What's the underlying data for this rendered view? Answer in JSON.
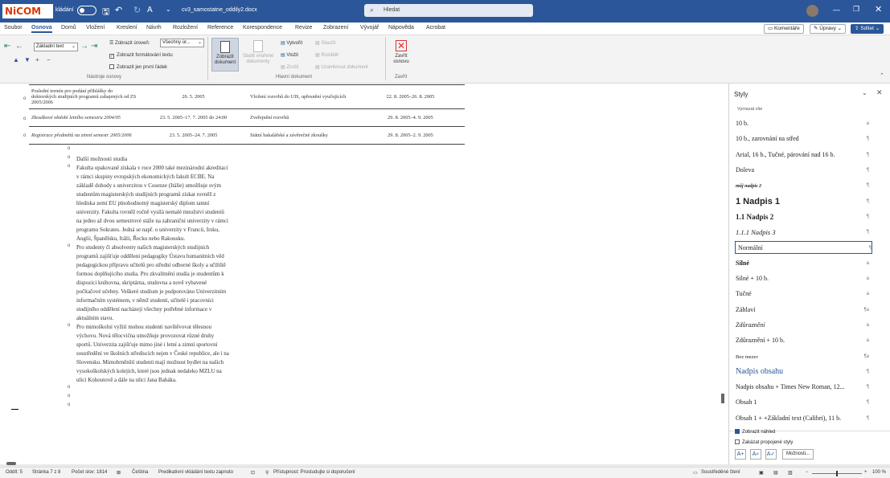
{
  "titlebar": {
    "logo": "NiCOM",
    "autosave": "kládání",
    "filename": "cv3_samostatne_oddily2.docx",
    "search_placeholder": "Hledat"
  },
  "menu": [
    "Soubor",
    "Osnova",
    "Domů",
    "Vložení",
    "Kreslení",
    "Návrh",
    "Rozložení",
    "Reference",
    "Korespondence",
    "Revize",
    "Zobrazení",
    "Vývojář",
    "Nápověda",
    "Acrobat"
  ],
  "menu_right": {
    "comments": "Komentáře",
    "edit": "Úpravy",
    "share": "Sdílet"
  },
  "ribbon": {
    "level_select": "Základní text",
    "show_level_label": "Zobrazit úroveň:",
    "show_level_value": "Všechny úr...",
    "show_formatting": "Zobrazit formátování textu",
    "show_first_line": "Zobrazit jen první řádek",
    "group1": "Nástroje osnovy",
    "show_document": "Zobrazit dokument",
    "collapse_subdocs": "Sbalit vnořené dokumenty",
    "create": "Vytvořit",
    "insert": "Vložit",
    "unlink": "Zrušit",
    "merge": "Sloučit",
    "split": "Rozdělit",
    "lock": "Uzamknout dokument",
    "group2": "Hlavní dokument",
    "close_outline": "Zavřít osnovu",
    "group3": "Zavřít"
  },
  "table_rows": [
    [
      "Poslední termín pro podání přihlášky do doktorských studijních programů zahajených od ZS 2005/2006",
      "20. 5. 2005",
      "Vložení rozvrhů do UIS, upřesnění vyučujících",
      "22. 8. 2005–26. 8. 2005"
    ],
    [
      "Zkouškové období letního semestru 2004/05",
      "23. 5. 2005–17. 7. 2005 do 24:00",
      "Zveřejnění rozvrhů",
      "29. 8. 2005–4. 9. 2005"
    ],
    [
      "Registrace předmětů na zimní semestr 2005/2006",
      "23. 5. 2005–24. 7. 2005",
      "Státní bakalářské a závěrečné zkoušky",
      "29. 8. 2005–2. 9. 2005"
    ]
  ],
  "doc_heading": "Další možnosti studia",
  "doc_paras": [
    [
      "Fakulta opakovaně získala v roce 2000 také mezinárodní akreditaci",
      "v rámci skupiny evropských ekonomických fakult ECBE. Na",
      "základě dohody s univerzitou v Cosenze (Itálie) umožňuje svým",
      "studentům magisterských studijních programů získat rovněž z",
      "hlediska zemí EU plnohodnotný magisterský diplom tamní",
      "univerzity. Fakulta rovněž ročně vysílá nemalé množství studentů",
      "na jedno až dvou semestrové stáže na zahraniční univerzity v rámci",
      "programu Sokrates. Jedná se např. o univerzity v Francii, Irsku,",
      "Anglii, Španělsku, Itálii, Řecku nebo Rakousku."
    ],
    [
      "Pro studenty či absolventy našich magisterských studijních",
      "programů zajišťuje oddělení pedagogiky Ústavu humanitních věd",
      "pedagogickou přípravu učitelů pro střední odborné školy a učiliště",
      "formou doplňujícího studia. Pro zkvalitnění studia je studentům k",
      "dispozici knihovna, skriptárna, studovna a nově vybavené",
      "počítačové učebny. Veškeré studium je podporováno Univerzitním",
      "informačním systémem, v němž studenti, učitelé i pracovníci",
      "studijního oddělení nacházejí všechny potřebné informace v",
      "aktuálním stavu."
    ],
    [
      "Pro mimoškolní vyžití mohou studenti navštěvovat tělesnou",
      "výchovu. Nová tělocvična umožňuje provozovat různé druhy",
      "sportů. Univerzita zajišťuje mimo jiné i letní a zimní sportovní",
      "soustředění ve školních střediscích nejen v České republice, ale i na",
      "Slovensku. Mimobrněnští studenti mají možnost bydlet na našich",
      "vysokoškolských kolejích, které jsou jednak nedaleko MZLU na",
      "ulici Kohoutově a dále na ulici Jana Babáka."
    ]
  ],
  "pane": {
    "title": "Styly",
    "clear_all": "Vymazat vše",
    "styles": [
      {
        "name": "10 b.",
        "sym": "a"
      },
      {
        "name": "10 b., zarovnání na střed",
        "sym": "¶"
      },
      {
        "name": "Arial, 16 b., Tučné, párování nad 16 b.",
        "sym": "¶"
      },
      {
        "name": "Doleva",
        "sym": "¶"
      },
      {
        "name": "můj nadpis 2",
        "sym": "¶"
      },
      {
        "name": "1  Nadpis 1",
        "sym": "¶"
      },
      {
        "name": "1.1  Nadpis 2",
        "sym": "¶"
      },
      {
        "name": "1.1.1  Nadpis 3",
        "sym": "¶"
      },
      {
        "name": "Normální",
        "sym": "¶"
      },
      {
        "name": "Silné",
        "sym": "a"
      },
      {
        "name": "Silné + 10 b.",
        "sym": "a"
      },
      {
        "name": "Tučné",
        "sym": "a"
      },
      {
        "name": "Záhlaví",
        "sym": "¶a"
      },
      {
        "name": "Zdůraznění",
        "sym": "a"
      },
      {
        "name": "Zdůraznění + 10 b.",
        "sym": "a"
      },
      {
        "name": "Bez mezer",
        "sym": "¶a"
      },
      {
        "name": "Nadpis obsahu",
        "sym": "¶"
      },
      {
        "name": "Nadpis obsahu + Times New Roman, 12...",
        "sym": "¶"
      },
      {
        "name": "Obsah 1",
        "sym": "¶"
      },
      {
        "name": "Obsah 1 + +Základní text (Calibri), 11 b.",
        "sym": "¶"
      }
    ],
    "show_preview": "Zobrazit náhled",
    "disable_linked": "Zakázat propojené styly",
    "options": "Možnosti..."
  },
  "status": {
    "section": "Oddíl: 5",
    "page": "Stránka 7 z 8",
    "words": "Počet slov: 1814",
    "lang": "Čeština",
    "predict": "Predikativní vkládání textu zapnuto",
    "access": "Přístupnost: Prostudujte si doporučení",
    "focus": "Soustředěné čtení",
    "zoom": "100 %"
  }
}
